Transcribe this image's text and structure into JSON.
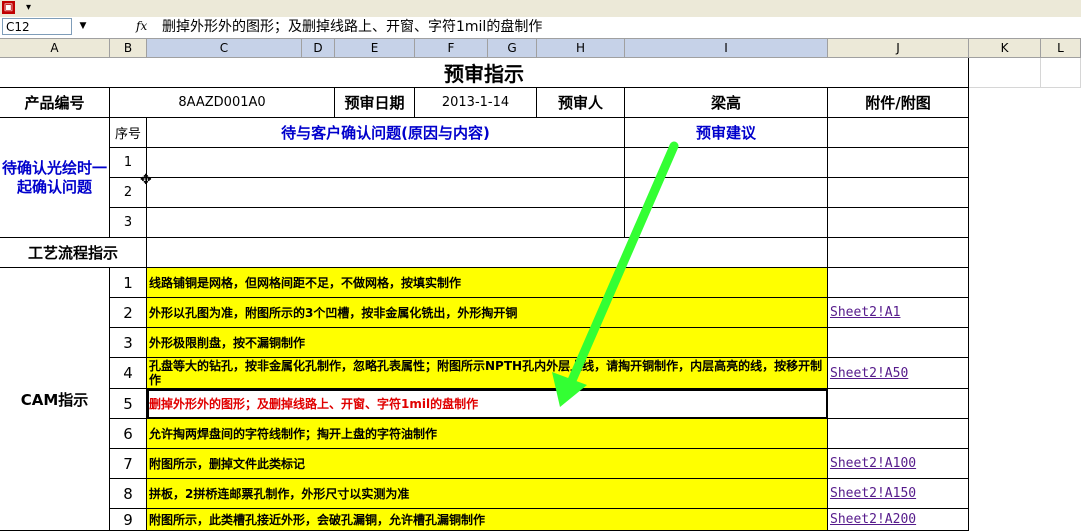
{
  "window": {
    "icons": [
      "excel-icon",
      "dropdown-icon"
    ]
  },
  "formula_bar": {
    "cell_ref": "C12",
    "fx": "fx",
    "content": "删掉外形外的图形；及删掉线路上、开窗、字符1mil的盘制作"
  },
  "columns": [
    "A",
    "B",
    "C",
    "D",
    "E",
    "F",
    "G",
    "H",
    "I",
    "J",
    "K",
    "L"
  ],
  "sheet": {
    "title": "预审指示",
    "product_label": "产品编号",
    "product_value": "8AAZD001A0",
    "date_label": "预审日期",
    "date_value": "2013-1-14",
    "reviewer_label": "预审人",
    "reviewer_value": "梁高",
    "attachment_label": "附件/附图",
    "pending_label": "待确认光绘时一起确认问题",
    "seq_label": "序号",
    "confirm_header": "待与客户确认问题(原因与内容)",
    "advice_header": "预审建议",
    "confirm_rows": [
      "1",
      "2",
      "3"
    ],
    "process_label": "工艺流程指示",
    "cam_label": "CAM指示",
    "cam_rows": [
      {
        "num": "1",
        "text": "线路铺铜是网格，但网格间距不足，不做网格，按填实制作",
        "link": ""
      },
      {
        "num": "2",
        "text": "外形以孔图为准，附图所示的3个凹槽，按非金属化铣出，外形掏开铜",
        "link": "Sheet2!A1"
      },
      {
        "num": "3",
        "text": "外形极限削盘，按不漏铜制作",
        "link": ""
      },
      {
        "num": "4",
        "text": "孔盘等大的钻孔，按非金属化孔制作，忽略孔表属性；附图所示NPTH孔内外层上线，请掏开铜制作，内层高亮的线，按移开制作",
        "link": "Sheet2!A50"
      },
      {
        "num": "5",
        "text": "删掉外形外的图形；及删掉线路上、开窗、字符1mil的盘制作",
        "link": ""
      },
      {
        "num": "6",
        "text": "允许掏两焊盘间的字符线制作；掏开上盘的字符油制作",
        "link": ""
      },
      {
        "num": "7",
        "text": "附图所示，删掉文件此类标记",
        "link": "Sheet2!A100"
      },
      {
        "num": "8",
        "text": "拼板，2拼桥连邮票孔制作，外形尺寸以实测为准",
        "link": "Sheet2!A150"
      },
      {
        "num": "9",
        "text": "附图所示，此类槽孔接近外形，会破孔漏铜，允许槽孔漏铜制作",
        "link": "Sheet2!A200"
      }
    ]
  },
  "colors": {
    "highlight": "#ffff00",
    "header_blue": "#0000cc",
    "arrow": "#33ff33",
    "red_text": "#e00000"
  }
}
